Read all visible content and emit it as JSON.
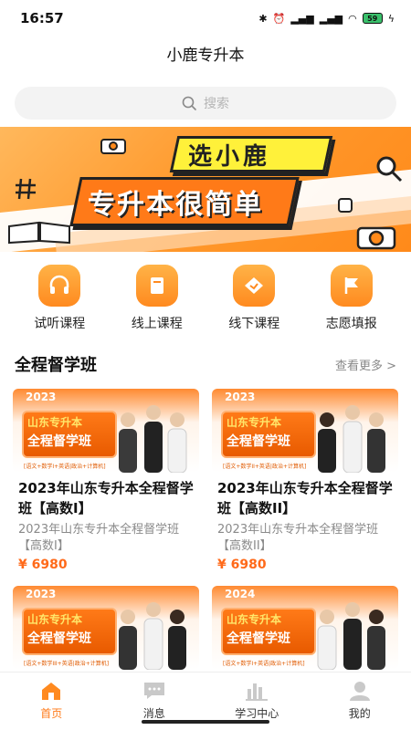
{
  "status": {
    "time": "16:57",
    "battery": "59"
  },
  "app": {
    "title": "小鹿专升本"
  },
  "search": {
    "placeholder": "搜索"
  },
  "banner": {
    "tag": "选小鹿",
    "headline": "专升本很简单"
  },
  "categories": [
    {
      "label": "试听课程",
      "icon": "headset-icon"
    },
    {
      "label": "线上课程",
      "icon": "book-icon"
    },
    {
      "label": "线下课程",
      "icon": "diamond-icon"
    },
    {
      "label": "志愿填报",
      "icon": "flag-icon"
    }
  ],
  "section": {
    "title": "全程督学班",
    "more": "查看更多 >"
  },
  "courses": [
    {
      "year": "2023",
      "badge_line1": "山东专升本",
      "badge_line2": "全程督学班",
      "subjects": "[语文+数学I+英语|政治+计算机]",
      "title": "2023年山东专升本全程督学班【高数I】",
      "subtitle": "2023年山东专升本全程督学班【高数I】",
      "price": "¥ 6980"
    },
    {
      "year": "2023",
      "badge_line1": "山东专升本",
      "badge_line2": "全程督学班",
      "subjects": "[语文+数学II+英语|政治+计算机]",
      "title": "2023年山东专升本全程督学班【高数II】",
      "subtitle": "2023年山东专升本全程督学班【高数II】",
      "price": "¥ 6980"
    },
    {
      "year": "2023",
      "badge_line1": "山东专升本",
      "badge_line2": "全程督学班",
      "subjects": "[语文+数学III+英语|政治+计算机]"
    },
    {
      "year": "2024",
      "badge_line1": "山东专升本",
      "badge_line2": "全程督学班",
      "subjects": "[语文+数学I+英语|政治+计算机]"
    }
  ],
  "tabs": [
    {
      "label": "首页",
      "icon": "home-icon",
      "active": true
    },
    {
      "label": "消息",
      "icon": "message-icon",
      "active": false
    },
    {
      "label": "学习中心",
      "icon": "study-center-icon",
      "active": false
    },
    {
      "label": "我的",
      "icon": "profile-icon",
      "active": false
    }
  ],
  "colors": {
    "accent": "#ff7a18",
    "price": "#ff6a1a"
  }
}
